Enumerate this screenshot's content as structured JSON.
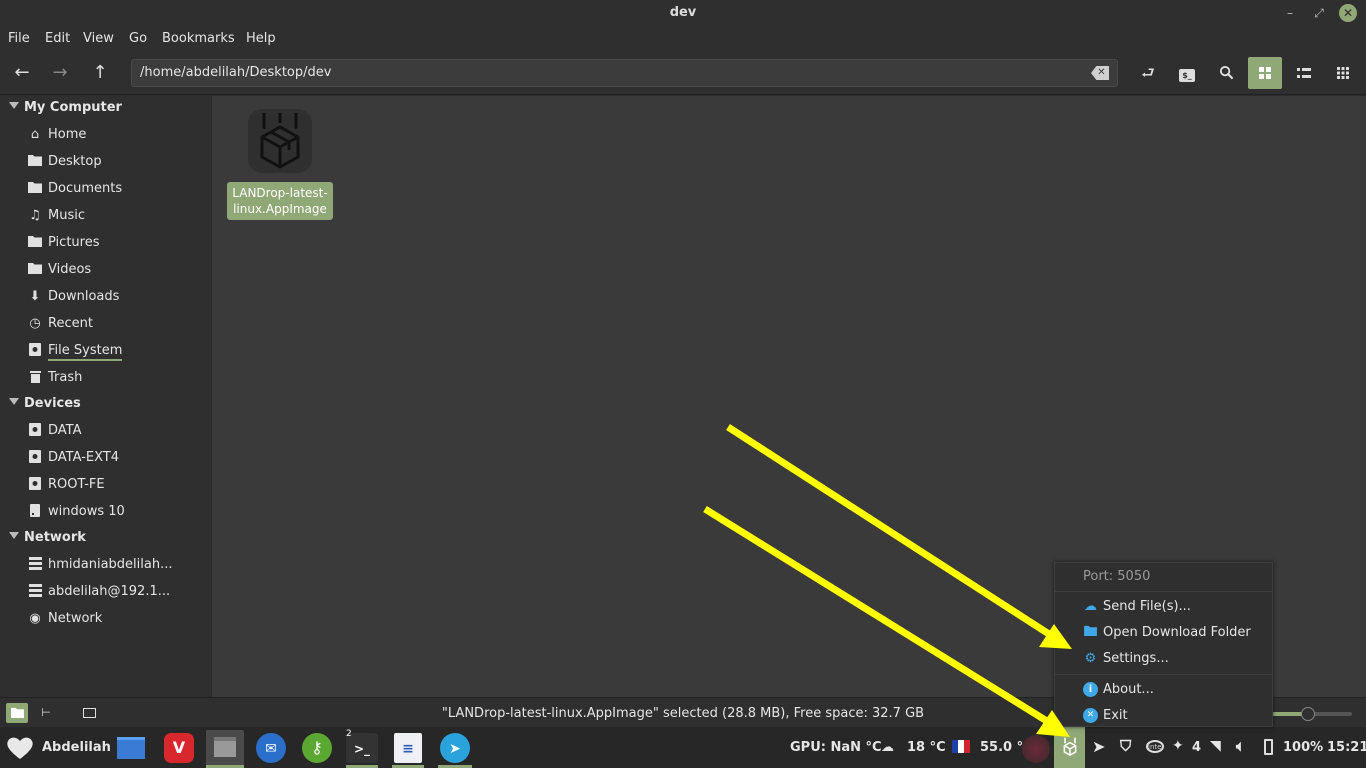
{
  "window": {
    "title": "dev"
  },
  "menubar": {
    "items": [
      "File",
      "Edit",
      "View",
      "Go",
      "Bookmarks",
      "Help"
    ]
  },
  "toolbar": {
    "path": "/home/abdelilah/Desktop/dev"
  },
  "sidebar": {
    "sections": [
      {
        "label": "My Computer",
        "items": [
          {
            "label": "Home",
            "icon": "home-icon"
          },
          {
            "label": "Desktop",
            "icon": "folder-icon"
          },
          {
            "label": "Documents",
            "icon": "folder-icon"
          },
          {
            "label": "Music",
            "icon": "music-icon"
          },
          {
            "label": "Pictures",
            "icon": "folder-icon"
          },
          {
            "label": "Videos",
            "icon": "folder-icon"
          },
          {
            "label": "Downloads",
            "icon": "download-icon"
          },
          {
            "label": "Recent",
            "icon": "clock-icon"
          },
          {
            "label": "File System",
            "icon": "drive-icon"
          },
          {
            "label": "Trash",
            "icon": "trash-icon"
          }
        ]
      },
      {
        "label": "Devices",
        "items": [
          {
            "label": "DATA",
            "icon": "drive-icon"
          },
          {
            "label": "DATA-EXT4",
            "icon": "drive-icon"
          },
          {
            "label": "ROOT-FE",
            "icon": "drive-icon"
          },
          {
            "label": "windows 10",
            "icon": "drive-icon"
          }
        ]
      },
      {
        "label": "Network",
        "items": [
          {
            "label": "hmidaniabdelilah...",
            "icon": "server-icon"
          },
          {
            "label": "abdelilah@192.1...",
            "icon": "server-icon"
          },
          {
            "label": "Network",
            "icon": "network-icon"
          }
        ]
      }
    ]
  },
  "content": {
    "file": {
      "name": "LANDrop-latest-linux.AppImage",
      "name_line1": "LANDrop-latest-",
      "name_line2": "linux.AppImage"
    }
  },
  "statusbar": {
    "text": "\"LANDrop-latest-linux.AppImage\" selected (28.8 MB), Free space: 32.7 GB",
    "zoom_fraction": 0.45
  },
  "popup": {
    "header": "Port: 5050",
    "items": [
      {
        "label": "Send File(s)...",
        "icon": "cloud-upload-icon"
      },
      {
        "label": "Open Download Folder",
        "icon": "folder-icon"
      },
      {
        "label": "Settings...",
        "icon": "gear-icon"
      },
      {
        "label": "About...",
        "icon": "info-icon"
      },
      {
        "label": "Exit",
        "icon": "close-circle-icon"
      }
    ]
  },
  "taskbar": {
    "user": "Abdelilah",
    "workspace_badge": "2",
    "gpu": "GPU: NaN °C",
    "weather": "18 °C",
    "cpu": "55.0 °",
    "notifications": "4",
    "battery": "100%",
    "clock": "15:21"
  },
  "colors": {
    "accent": "#8fa876",
    "annotation_arrow": "#ffff00",
    "popup_icon": "#3fa9e8"
  }
}
